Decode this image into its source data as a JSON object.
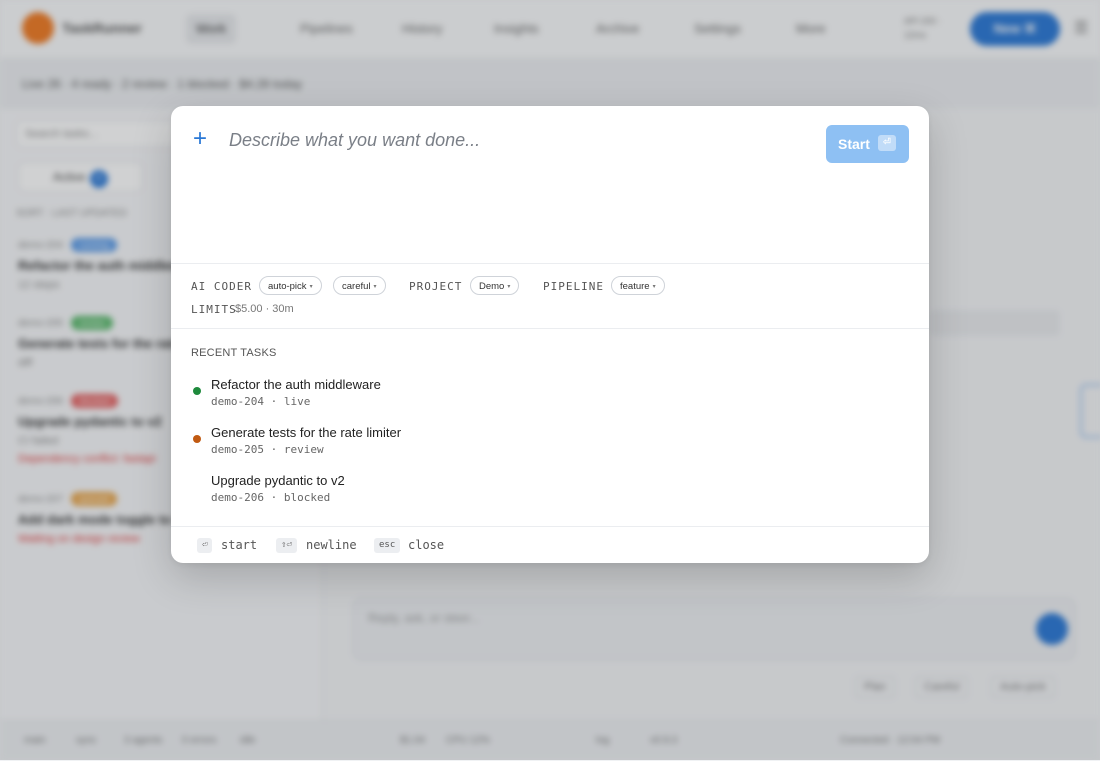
{
  "background": {
    "app_name": "TaskRunner",
    "nav": [
      "Work",
      "Pipelines",
      "History",
      "Insights",
      "Archive",
      "Settings",
      "More"
    ],
    "gh_status": "API 200 · 12ms",
    "new_button": "New ⌘",
    "subheader": "Live 26 · 4 ready · 2 review · 1 blocked · $4.28 today",
    "search_placeholder": "Search tasks...",
    "active_tab": "Active",
    "active_count": "4",
    "list_heading": "SORT · LAST UPDATED",
    "items": [
      {
        "meta": "demo-204",
        "badge": "running",
        "title": "Refactor the auth middleware",
        "sub": "12 steps"
      },
      {
        "meta": "demo-205",
        "badge": "review",
        "title": "Generate tests for the rate limiter",
        "sub": "diff"
      },
      {
        "meta": "demo-206",
        "badge": "blocked",
        "title": "Upgrade pydantic to v2",
        "sub": "CI failed",
        "warn": "Dependency conflict: fastapi"
      },
      {
        "meta": "demo-207",
        "badge": "queued",
        "title": "Add dark mode toggle to settings",
        "warn": "Waiting on design review"
      }
    ],
    "chat_placeholder": "Reply, ask, or steer...",
    "chat_options": [
      "Plan",
      "Careful",
      "Auto-pick"
    ],
    "status_items": [
      "main",
      "sync",
      "3 agents",
      "0 errors",
      "idle",
      "$1.04",
      "CPU 12%",
      "log",
      "v0.9.3",
      "Connected · 12:04 PM"
    ]
  },
  "modal": {
    "input_placeholder": "Describe what you want done...",
    "start_label": "Start",
    "start_key": "⏎",
    "config": {
      "ai_coder_label": "AI CODER",
      "ai_coder_model": "auto-pick",
      "ai_coder_mode": "careful",
      "project_label": "PROJECT",
      "project_value": "Demo",
      "pipeline_label": "PIPELINE",
      "pipeline_value": "feature",
      "limits_label": "LIMITS",
      "limits_value": "$5.00 · 30m"
    },
    "recent_heading": "RECENT TASKS",
    "recent": [
      {
        "title": "Refactor the auth middleware",
        "meta": "demo-204 · live",
        "status": "live",
        "dot_color": "#1e8a3c"
      },
      {
        "title": "Generate tests for the rate limiter",
        "meta": "demo-205 · review",
        "status": "review",
        "dot_color": "#c15a12"
      },
      {
        "title": "Upgrade pydantic to v2",
        "meta": "demo-206 · blocked",
        "status": "blocked",
        "dot_color": "#ffffff"
      }
    ],
    "shortcuts": [
      {
        "key": "⏎",
        "label": "start"
      },
      {
        "key": "⇧⏎",
        "label": "newline"
      },
      {
        "key": "esc",
        "label": "close"
      }
    ]
  },
  "colors": {
    "accent": "#2a78d6",
    "start_button": "#8ec0f3",
    "live": "#1e8a3c",
    "review": "#c15a12",
    "badge_running": "#5b9be8",
    "badge_review": "#58b86a",
    "badge_blocked": "#e46161",
    "badge_queued": "#e8a64c"
  }
}
